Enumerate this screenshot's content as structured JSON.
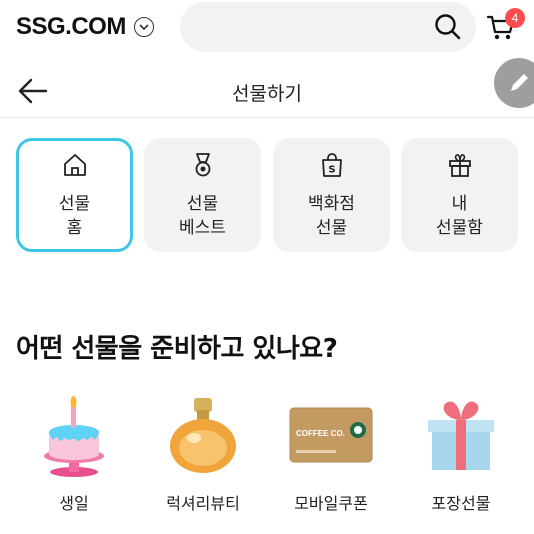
{
  "topbar": {
    "logo": "SSG.COM",
    "cart_count": "4"
  },
  "header": {
    "title": "선물하기"
  },
  "tabs": [
    {
      "line1": "선물",
      "line2": "홈",
      "icon": "house-icon",
      "active": true
    },
    {
      "line1": "선물",
      "line2": "베스트",
      "icon": "medal-icon",
      "active": false
    },
    {
      "line1": "백화점",
      "line2": "선물",
      "icon": "shopping-bag-icon",
      "active": false
    },
    {
      "line1": "내",
      "line2": "선물함",
      "icon": "gift-icon",
      "active": false
    }
  ],
  "section": {
    "title": "어떤 선물을 준비하고 있나요?"
  },
  "categories": [
    {
      "label": "생일",
      "icon": "birthday-cake-icon"
    },
    {
      "label": "럭셔리뷰티",
      "icon": "perfume-bottle-icon"
    },
    {
      "label": "모바일쿠폰",
      "icon": "gift-card-icon"
    },
    {
      "label": "포장선물",
      "icon": "gift-box-icon"
    }
  ],
  "gift_card_text": "COFFEE CO.",
  "colors": {
    "active_border": "#3dc6e6",
    "badge": "#ff4b4b",
    "tab_bg": "#f2f2f2"
  }
}
